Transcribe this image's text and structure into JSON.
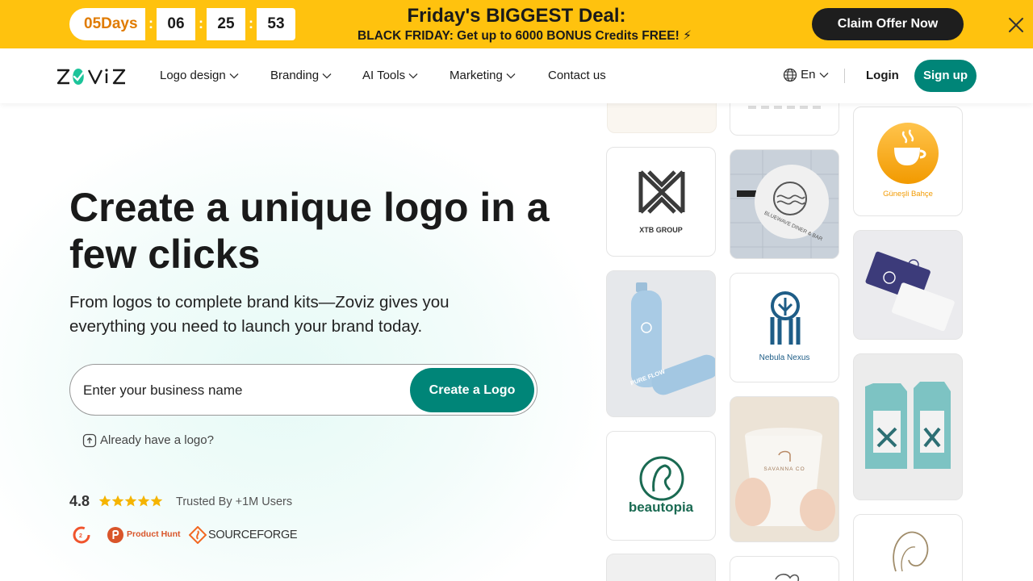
{
  "promo": {
    "countdown": {
      "days": "05Days",
      "hours": "06",
      "minutes": "25",
      "seconds": "53",
      "separator": ":"
    },
    "title": "Friday's BIGGEST Deal:",
    "subtitle": "BLACK FRIDAY: Get up to 6000 BONUS Credits FREE! ⚡",
    "cta": "Claim Offer Now",
    "close_icon": "close-icon",
    "bg_color": "#ffc20e"
  },
  "nav": {
    "brand": "ZOVIZ",
    "items": [
      {
        "label": "Logo design",
        "dropdown": true
      },
      {
        "label": "Branding",
        "dropdown": true
      },
      {
        "label": "AI Tools",
        "dropdown": true
      },
      {
        "label": "Marketing",
        "dropdown": true
      },
      {
        "label": "Contact us",
        "dropdown": false
      }
    ],
    "language": "En",
    "login": "Login",
    "signup": "Sign up"
  },
  "hero": {
    "title": "Create a unique logo in a few clicks",
    "subtitle": "From logos to complete brand kits—Zoviz gives you everything you need to launch your brand today.",
    "input_placeholder": "Enter your business name",
    "cta": "Create a Logo",
    "have_logo": "Already have a logo?",
    "rating": "4.8",
    "stars": 5,
    "trusted": "Trusted By +1M Users",
    "badges": [
      "g2-icon",
      "product-hunt-icon",
      "sourceforge-icon"
    ],
    "badge_labels": {
      "product_hunt": "Product Hunt",
      "sourceforge": "SOURCEFORGE"
    }
  },
  "gallery": {
    "xtb": "XTB GROUP",
    "bluewave": "BLUEWAVE DINER & BAR",
    "gunesli": "Güneşli Bahçe",
    "nebula": "Nebula Nexus",
    "beautopia": "beautopia",
    "pureflow": "PURE FLOW",
    "savanna": "SAVANNA CO"
  },
  "colors": {
    "primary": "#008578",
    "accent": "#ffc20e",
    "dark": "#1e1e1e"
  }
}
